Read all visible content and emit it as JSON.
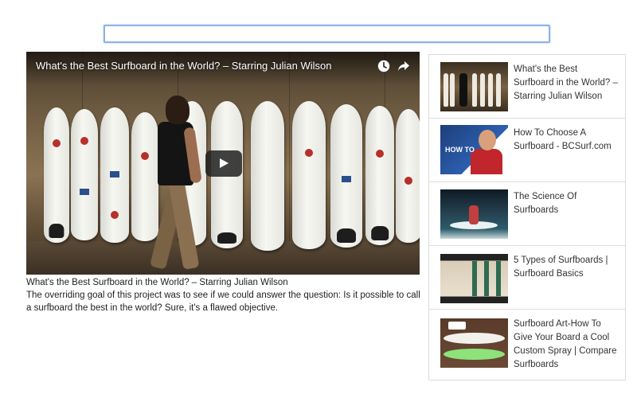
{
  "search": {
    "value": "",
    "placeholder": ""
  },
  "player": {
    "title": "What's the Best Surfboard in the World? – Starring Julian Wilson",
    "watch_later_icon": "clock-icon",
    "share_icon": "share-arrow-icon",
    "play_icon": "play-icon"
  },
  "video": {
    "caption": "What's the Best Surfboard in the World? – Starring Julian Wilson",
    "description": "The overriding goal of this project was to see if we could answer the question: Is it possible to call a surfboard the best in the world? Sure, it's a flawed objective."
  },
  "playlist": {
    "items": [
      {
        "title": "What's the Best Surfboard in the World? – Starring Julian Wilson"
      },
      {
        "title": "How To Choose A Surfboard - BCSurf.com",
        "thumb_text": "HOW TO"
      },
      {
        "title": "The Science Of Surfboards"
      },
      {
        "title": "5 Types of Surfboards | Surfboard Basics"
      },
      {
        "title": "Surfboard Art-How To Give Your Board a Cool Custom Spray | Compare Surfboards"
      }
    ]
  },
  "colors": {
    "search_border": "#8fb2e6",
    "play_button_bg": "#212121",
    "divider": "#dcdcdc"
  }
}
